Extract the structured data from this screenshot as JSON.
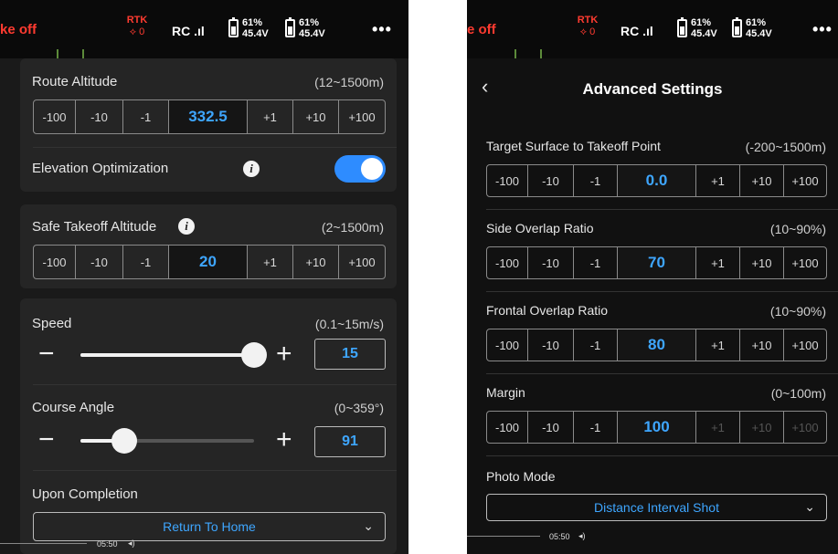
{
  "status_bar": {
    "takeoff_left": "ke off",
    "takeoff_right": "e off",
    "rtk_label": "RTK",
    "rtk_count": "0",
    "rc_label": "RC",
    "battery1_pct": "61%",
    "battery1_v": "45.4V",
    "battery2_pct": "61%",
    "battery2_v": "45.4V",
    "more": "•••"
  },
  "left": {
    "route_altitude": {
      "label": "Route Altitude",
      "range": "(12~1500m)",
      "steps": [
        "-100",
        "-10",
        "-1",
        "332.5",
        "+1",
        "+10",
        "+100"
      ]
    },
    "elevation_optimization": {
      "label": "Elevation Optimization",
      "enabled": true
    },
    "safe_takeoff": {
      "label": "Safe Takeoff Altitude",
      "range": "(2~1500m)",
      "steps": [
        "-100",
        "-10",
        "-1",
        "20",
        "+1",
        "+10",
        "+100"
      ]
    },
    "speed": {
      "label": "Speed",
      "range": "(0.1~15m/s)",
      "value": "15",
      "level": 1.0
    },
    "course_angle": {
      "label": "Course Angle",
      "range": "(0~359°)",
      "value": "91",
      "level": 0.25
    },
    "upon_completion": {
      "label": "Upon Completion",
      "selected": "Return To Home"
    },
    "video_time": "05:50"
  },
  "right": {
    "title": "Advanced Settings",
    "target_surface": {
      "label": "Target Surface to Takeoff Point",
      "range": "(-200~1500m)",
      "steps": [
        "-100",
        "-10",
        "-1",
        "0.0",
        "+1",
        "+10",
        "+100"
      ]
    },
    "side_overlap": {
      "label": "Side Overlap Ratio",
      "range": "(10~90%)",
      "steps": [
        "-100",
        "-10",
        "-1",
        "70",
        "+1",
        "+10",
        "+100"
      ]
    },
    "frontal_overlap": {
      "label": "Frontal Overlap Ratio",
      "range": "(10~90%)",
      "steps": [
        "-100",
        "-10",
        "-1",
        "80",
        "+1",
        "+10",
        "+100"
      ]
    },
    "margin": {
      "label": "Margin",
      "range": "(0~100m)",
      "steps": [
        "-100",
        "-10",
        "-1",
        "100",
        "+1",
        "+10",
        "+100"
      ]
    },
    "photo_mode": {
      "label": "Photo Mode",
      "selected": "Distance Interval Shot"
    },
    "video_time": "05:50"
  },
  "colors": {
    "accent": "#3ea6ff",
    "toggle_on": "#2e8cff",
    "warning": "#ff3b30"
  }
}
